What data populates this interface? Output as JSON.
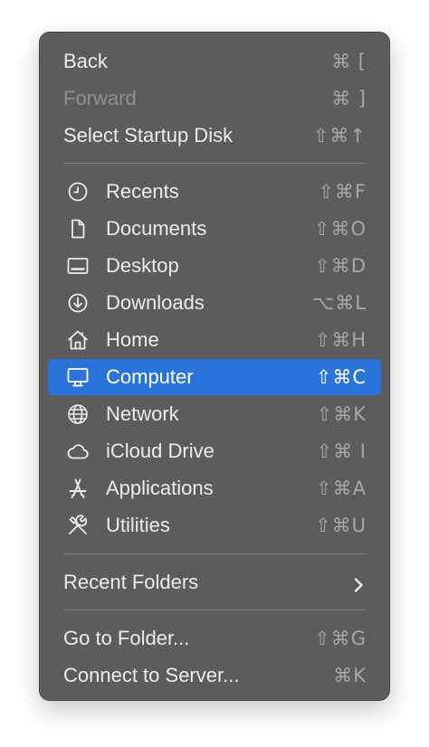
{
  "nav": {
    "back": {
      "label": "Back",
      "shortcut": "⌘ ["
    },
    "forward": {
      "label": "Forward",
      "shortcut": "⌘ ]"
    },
    "startup": {
      "label": "Select Startup Disk",
      "shortcut": "⇧⌘↑"
    }
  },
  "places": [
    {
      "label": "Recents",
      "shortcut": "⇧⌘F",
      "icon": "clock-icon"
    },
    {
      "label": "Documents",
      "shortcut": "⇧⌘O",
      "icon": "document-icon"
    },
    {
      "label": "Desktop",
      "shortcut": "⇧⌘D",
      "icon": "desktop-icon"
    },
    {
      "label": "Downloads",
      "shortcut": "⌥⌘L",
      "icon": "download-icon"
    },
    {
      "label": "Home",
      "shortcut": "⇧⌘H",
      "icon": "home-icon"
    },
    {
      "label": "Computer",
      "shortcut": "⇧⌘C",
      "icon": "computer-icon"
    },
    {
      "label": "Network",
      "shortcut": "⇧⌘K",
      "icon": "globe-icon"
    },
    {
      "label": "iCloud Drive",
      "shortcut": "⇧⌘ I",
      "icon": "cloud-icon"
    },
    {
      "label": "Applications",
      "shortcut": "⇧⌘A",
      "icon": "applications-icon"
    },
    {
      "label": "Utilities",
      "shortcut": "⇧⌘U",
      "icon": "tools-icon"
    }
  ],
  "recent_folders": {
    "label": "Recent Folders",
    "icon": "chevron-right-icon"
  },
  "goto": {
    "folder": {
      "label": "Go to Folder...",
      "shortcut": "⇧⌘G"
    },
    "server": {
      "label": "Connect to Server...",
      "shortcut": "⌘K"
    }
  },
  "colors": {
    "menu_bg": "#5b5c5e",
    "highlight": "#2a74d9",
    "text": "#ececec",
    "disabled_text": "#8e8f91"
  }
}
